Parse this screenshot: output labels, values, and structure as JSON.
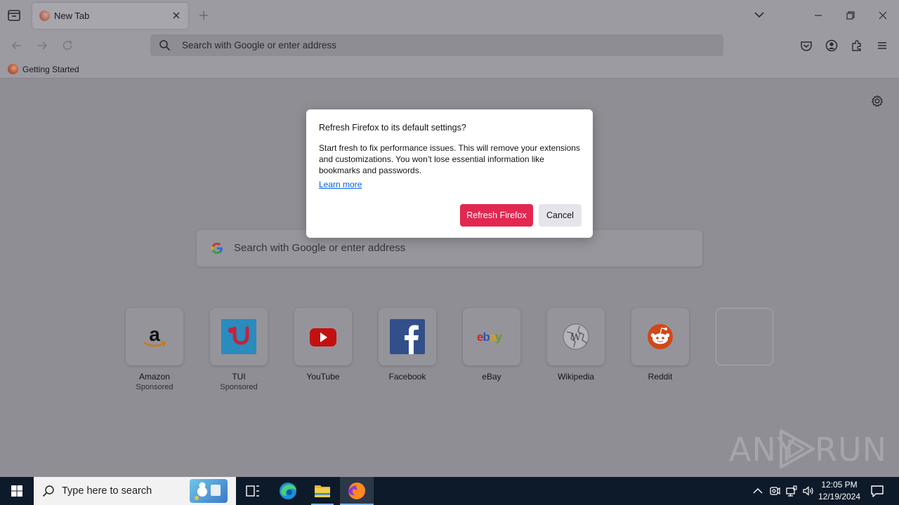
{
  "browser": {
    "tab_title": "New Tab",
    "urlbar_placeholder": "Search with Google or enter address",
    "bookmark_label": "Getting Started"
  },
  "newtab": {
    "search_placeholder": "Search with Google or enter address",
    "tiles": [
      {
        "label": "Amazon",
        "sponsor": "Sponsored",
        "icon": "amazon-icon"
      },
      {
        "label": "TUI",
        "sponsor": "Sponsored",
        "icon": "tui-icon"
      },
      {
        "label": "YouTube",
        "sponsor": "",
        "icon": "youtube-icon"
      },
      {
        "label": "Facebook",
        "sponsor": "",
        "icon": "facebook-icon"
      },
      {
        "label": "eBay",
        "sponsor": "",
        "icon": "ebay-icon"
      },
      {
        "label": "Wikipedia",
        "sponsor": "",
        "icon": "wikipedia-icon"
      },
      {
        "label": "Reddit",
        "sponsor": "",
        "icon": "reddit-icon"
      }
    ]
  },
  "dialog": {
    "title": "Refresh Firefox to its default settings?",
    "body": "Start fresh to fix performance issues. This will remove your extensions and customizations. You won’t lose essential information like bookmarks and passwords.",
    "link": "Learn more",
    "primary_button": "Refresh Firefox",
    "secondary_button": "Cancel"
  },
  "taskbar": {
    "search_placeholder": "Type here to search",
    "time": "12:05 PM",
    "date": "12/19/2024"
  },
  "watermark": {
    "left": "ANY",
    "right": "RUN"
  },
  "colors": {
    "primary_button": "#e22850",
    "link": "#0061e0",
    "taskbar": "#0c1a2a"
  }
}
